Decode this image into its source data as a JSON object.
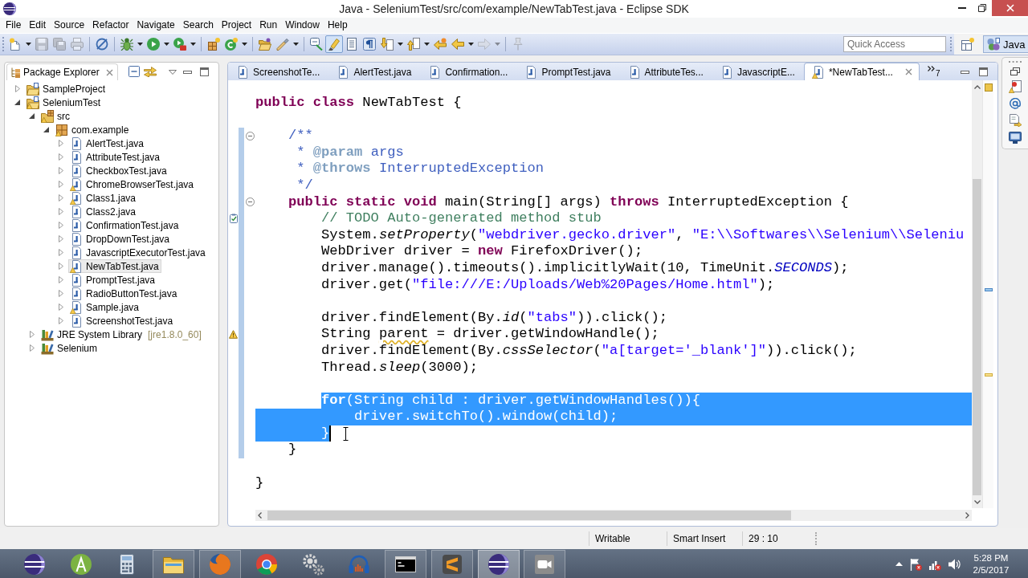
{
  "window": {
    "title": "Java - SeleniumTest/src/com/example/NewTabTest.java - Eclipse SDK"
  },
  "menu": [
    "File",
    "Edit",
    "Source",
    "Refactor",
    "Navigate",
    "Search",
    "Project",
    "Run",
    "Window",
    "Help"
  ],
  "toolbar": [
    [
      {
        "kind": "new",
        "disabled": false,
        "on": false
      },
      {
        "kind": "dropdown",
        "disabled": false,
        "on": false
      },
      {
        "kind": "save",
        "disabled": true,
        "on": false
      },
      {
        "kind": "save_all",
        "disabled": true,
        "on": false
      },
      {
        "kind": "print",
        "disabled": true,
        "on": false
      }
    ],
    [
      {
        "kind": "skip_breakpoints",
        "disabled": false,
        "on": false
      }
    ],
    [
      {
        "kind": "debug",
        "disabled": false,
        "on": false
      },
      {
        "kind": "dropdown",
        "disabled": false,
        "on": false
      },
      {
        "kind": "run",
        "disabled": false,
        "on": false
      },
      {
        "kind": "dropdown",
        "disabled": false,
        "on": false
      },
      {
        "kind": "coverage",
        "disabled": false,
        "on": false
      },
      {
        "kind": "dropdown",
        "disabled": false,
        "on": false
      }
    ],
    [
      {
        "kind": "new_package",
        "disabled": false,
        "on": false
      },
      {
        "kind": "new_class",
        "disabled": false,
        "on": false
      },
      {
        "kind": "dropdown",
        "disabled": false,
        "on": false
      }
    ],
    [
      {
        "kind": "open_type",
        "disabled": false,
        "on": false
      },
      {
        "kind": "search",
        "disabled": false,
        "on": false
      },
      {
        "kind": "dropdown",
        "disabled": false,
        "on": false
      }
    ],
    [
      {
        "kind": "breadcrumb",
        "disabled": false,
        "on": false
      },
      {
        "kind": "highlight",
        "disabled": false,
        "on": true
      },
      {
        "kind": "block_selection",
        "disabled": false,
        "on": false
      },
      {
        "kind": "whitespace",
        "disabled": false,
        "on": false
      },
      {
        "kind": "next_annotation",
        "disabled": false,
        "on": false
      },
      {
        "kind": "dropdown",
        "disabled": false,
        "on": false
      },
      {
        "kind": "prev_annotation",
        "disabled": false,
        "on": false
      },
      {
        "kind": "dropdown",
        "disabled": false,
        "on": false
      },
      {
        "kind": "last_edit",
        "disabled": false,
        "on": false
      },
      {
        "kind": "back",
        "disabled": false,
        "on": false
      },
      {
        "kind": "dropdown",
        "disabled": false,
        "on": false
      },
      {
        "kind": "forward",
        "disabled": true,
        "on": false
      },
      {
        "kind": "dropdown",
        "disabled": true,
        "on": false
      }
    ],
    [
      {
        "kind": "pin",
        "disabled": true,
        "on": false
      }
    ]
  ],
  "quick_access": {
    "placeholder": "Quick Access"
  },
  "perspectives": [
    {
      "label": "Java",
      "selected": true
    }
  ],
  "package_explorer": {
    "title": "Package Explorer",
    "tree": [
      {
        "label": "SampleProject",
        "kind": "project",
        "expanded": false,
        "warning": false,
        "selected": false
      },
      {
        "label": "SeleniumTest",
        "kind": "project",
        "expanded": true,
        "warning": true,
        "selected": false,
        "children": [
          {
            "label": "src",
            "kind": "source_folder",
            "expanded": true,
            "warning": true,
            "selected": false,
            "children": [
              {
                "label": "com.example",
                "kind": "package",
                "expanded": true,
                "warning": true,
                "selected": false,
                "children": [
                  {
                    "label": "AlertTest.java",
                    "kind": "java",
                    "expanded": false,
                    "warning": false,
                    "selected": false
                  },
                  {
                    "label": "AttributeTest.java",
                    "kind": "java",
                    "expanded": false,
                    "warning": false,
                    "selected": false
                  },
                  {
                    "label": "CheckboxTest.java",
                    "kind": "java",
                    "expanded": false,
                    "warning": false,
                    "selected": false
                  },
                  {
                    "label": "ChromeBrowserTest.java",
                    "kind": "java",
                    "expanded": false,
                    "warning": true,
                    "selected": false
                  },
                  {
                    "label": "Class1.java",
                    "kind": "java",
                    "expanded": false,
                    "warning": true,
                    "selected": false
                  },
                  {
                    "label": "Class2.java",
                    "kind": "java",
                    "expanded": false,
                    "warning": false,
                    "selected": false
                  },
                  {
                    "label": "ConfirmationTest.java",
                    "kind": "java",
                    "expanded": false,
                    "warning": false,
                    "selected": false
                  },
                  {
                    "label": "DropDownTest.java",
                    "kind": "java",
                    "expanded": false,
                    "warning": false,
                    "selected": false
                  },
                  {
                    "label": "JavascriptExecutorTest.java",
                    "kind": "java",
                    "expanded": false,
                    "warning": false,
                    "selected": false
                  },
                  {
                    "label": "NewTabTest.java",
                    "kind": "java",
                    "expanded": false,
                    "warning": true,
                    "selected": true
                  },
                  {
                    "label": "PromptTest.java",
                    "kind": "java",
                    "expanded": false,
                    "warning": false,
                    "selected": false
                  },
                  {
                    "label": "RadioButtonTest.java",
                    "kind": "java",
                    "expanded": false,
                    "warning": false,
                    "selected": false
                  },
                  {
                    "label": "Sample.java",
                    "kind": "java",
                    "expanded": false,
                    "warning": true,
                    "selected": false
                  },
                  {
                    "label": "ScreenshotTest.java",
                    "kind": "java",
                    "expanded": false,
                    "warning": false,
                    "selected": false
                  }
                ]
              }
            ]
          },
          {
            "label": "JRE System Library",
            "qualifier": "[jre1.8.0_60]",
            "kind": "library",
            "expanded": false,
            "warning": false,
            "selected": false
          },
          {
            "label": "Selenium",
            "kind": "library",
            "expanded": false,
            "warning": false,
            "selected": false
          }
        ]
      }
    ]
  },
  "editor": {
    "tabs": [
      {
        "label": "ScreenshotTe...",
        "selected": false,
        "warning": false
      },
      {
        "label": "AlertTest.java",
        "selected": false,
        "warning": false
      },
      {
        "label": "Confirmation...",
        "selected": false,
        "warning": false
      },
      {
        "label": "PromptTest.java",
        "selected": false,
        "warning": false
      },
      {
        "label": "AttributeTes...",
        "selected": false,
        "warning": false
      },
      {
        "label": "JavascriptE...",
        "selected": false,
        "warning": false
      },
      {
        "label": "*NewTabTest...",
        "selected": true,
        "warning": true
      }
    ],
    "overflow_count": "7",
    "lines": [
      {
        "segments": [
          {
            "text": "public class",
            "kind": "keyword"
          },
          {
            "text": " NewTabTest {",
            "kind": "plain"
          }
        ],
        "selected": false,
        "changed": false
      },
      {
        "selected": false,
        "changed": false
      },
      {
        "segments": [
          {
            "text": "    /**",
            "kind": "javadoc"
          }
        ],
        "selected": false,
        "changed": true,
        "fold": {
          "expanded": true
        }
      },
      {
        "segments": [
          {
            "text": "     * ",
            "kind": "javadoc"
          },
          {
            "text": "@param",
            "kind": "javadoc_tag"
          },
          {
            "text": " args",
            "kind": "javadoc"
          }
        ],
        "selected": false,
        "changed": true
      },
      {
        "segments": [
          {
            "text": "     * ",
            "kind": "javadoc"
          },
          {
            "text": "@throws",
            "kind": "javadoc_tag"
          },
          {
            "text": " InterruptedException",
            "kind": "javadoc"
          }
        ],
        "selected": false,
        "changed": true
      },
      {
        "segments": [
          {
            "text": "     */",
            "kind": "javadoc"
          }
        ],
        "selected": false,
        "changed": true
      },
      {
        "segments": [
          {
            "text": "    public static void",
            "kind": "keyword"
          },
          {
            "text": " main(String[] args) ",
            "kind": "plain"
          },
          {
            "text": "throws",
            "kind": "keyword"
          },
          {
            "text": " InterruptedException {",
            "kind": "plain"
          }
        ],
        "selected": false,
        "changed": true,
        "fold": {
          "expanded": true
        }
      },
      {
        "segments": [
          {
            "text": "        // TODO Auto-generated method stub",
            "kind": "comment"
          }
        ],
        "selected": false,
        "changed": true,
        "annotation": {
          "kind": "task"
        }
      },
      {
        "segments": [
          {
            "text": "        System.",
            "kind": "plain"
          },
          {
            "text": "setProperty",
            "kind": "static_method"
          },
          {
            "text": "(",
            "kind": "plain"
          },
          {
            "text": "\"webdriver.gecko.driver\"",
            "kind": "string"
          },
          {
            "text": ", ",
            "kind": "plain"
          },
          {
            "text": "\"E:\\\\Softwares\\\\Selenium\\\\Seleniu",
            "kind": "string"
          }
        ],
        "selected": false,
        "changed": true
      },
      {
        "segments": [
          {
            "text": "        WebDriver driver = ",
            "kind": "plain"
          },
          {
            "text": "new",
            "kind": "keyword"
          },
          {
            "text": " FirefoxDriver();",
            "kind": "plain"
          }
        ],
        "selected": false,
        "changed": true
      },
      {
        "segments": [
          {
            "text": "        driver.manage().timeouts().implicitlyWait(10, TimeUnit.",
            "kind": "plain"
          },
          {
            "text": "SECONDS",
            "kind": "constant"
          },
          {
            "text": ");",
            "kind": "plain"
          }
        ],
        "selected": false,
        "changed": true
      },
      {
        "segments": [
          {
            "text": "        driver.get(",
            "kind": "plain"
          },
          {
            "text": "\"file:///E:/Uploads/Web%20Pages/Home.html\"",
            "kind": "string"
          },
          {
            "text": ");",
            "kind": "plain"
          }
        ],
        "selected": false,
        "changed": true
      },
      {
        "selected": false,
        "changed": true
      },
      {
        "segments": [
          {
            "text": "        driver.findElement(By.",
            "kind": "plain"
          },
          {
            "text": "id",
            "kind": "static_method"
          },
          {
            "text": "(",
            "kind": "plain"
          },
          {
            "text": "\"tabs\"",
            "kind": "string"
          },
          {
            "text": ")).click();",
            "kind": "plain"
          }
        ],
        "selected": false,
        "changed": true
      },
      {
        "segments": [
          {
            "text": "        String ",
            "kind": "plain"
          },
          {
            "text": "parent",
            "kind": "unused"
          },
          {
            "text": " = driver.getWindowHandle();",
            "kind": "plain"
          }
        ],
        "selected": false,
        "changed": true,
        "annotation": {
          "kind": "warning"
        }
      },
      {
        "segments": [
          {
            "text": "        driver.findElement(By.",
            "kind": "plain"
          },
          {
            "text": "cssSelector",
            "kind": "static_method"
          },
          {
            "text": "(",
            "kind": "plain"
          },
          {
            "text": "\"a[target='_blank']\"",
            "kind": "string"
          },
          {
            "text": ")).click();",
            "kind": "plain"
          }
        ],
        "selected": false,
        "changed": true
      },
      {
        "segments": [
          {
            "text": "        Thread.",
            "kind": "plain"
          },
          {
            "text": "sleep",
            "kind": "static_method"
          },
          {
            "text": "(3000);",
            "kind": "plain"
          }
        ],
        "selected": false,
        "changed": true
      },
      {
        "selected": false,
        "changed": true
      },
      {
        "segments": [
          {
            "text": "        for",
            "kind": "keyword"
          },
          {
            "text": "(String child : driver.getWindowHandles()){",
            "kind": "plain"
          }
        ],
        "selected": true,
        "indent_selected": false,
        "selection_to_edge": true,
        "changed": true
      },
      {
        "segments": [
          {
            "text": "            driver.switchTo().window(child);",
            "kind": "plain"
          }
        ],
        "selected": true,
        "indent_selected": true,
        "selection_to_edge": true,
        "changed": true
      },
      {
        "segments": [
          {
            "text": "        }",
            "kind": "plain"
          }
        ],
        "selected": true,
        "indent_selected": true,
        "selection_to_edge": false,
        "changed": true
      },
      {
        "segments": [
          {
            "text": "    }",
            "kind": "plain"
          }
        ],
        "selected": false,
        "changed": true
      },
      {
        "selected": false,
        "changed": false
      },
      {
        "segments": [
          {
            "text": "}",
            "kind": "plain"
          }
        ],
        "selected": false,
        "changed": false
      }
    ]
  },
  "status_bar": [
    "Writable",
    "Smart Insert",
    "29 : 10"
  ],
  "taskbar": {
    "apps": [
      {
        "kind": "eclipse",
        "running": false,
        "active": false
      },
      {
        "kind": "android_studio",
        "running": false,
        "active": false
      },
      {
        "kind": "calculator",
        "running": false,
        "active": false
      },
      {
        "kind": "explorer",
        "running": true,
        "active": false
      },
      {
        "kind": "firefox",
        "running": true,
        "active": false
      },
      {
        "kind": "chrome",
        "running": false,
        "active": false
      },
      {
        "kind": "settings",
        "running": false,
        "active": false
      },
      {
        "kind": "audacity",
        "running": false,
        "active": false
      },
      {
        "kind": "cmd",
        "running": true,
        "active": false
      },
      {
        "kind": "sublime",
        "running": true,
        "active": false
      },
      {
        "kind": "eclipse",
        "running": true,
        "active": true
      },
      {
        "kind": "capture",
        "running": true,
        "active": false
      }
    ],
    "tray": {
      "time": "5:28 PM",
      "date": "2/5/2017"
    }
  }
}
